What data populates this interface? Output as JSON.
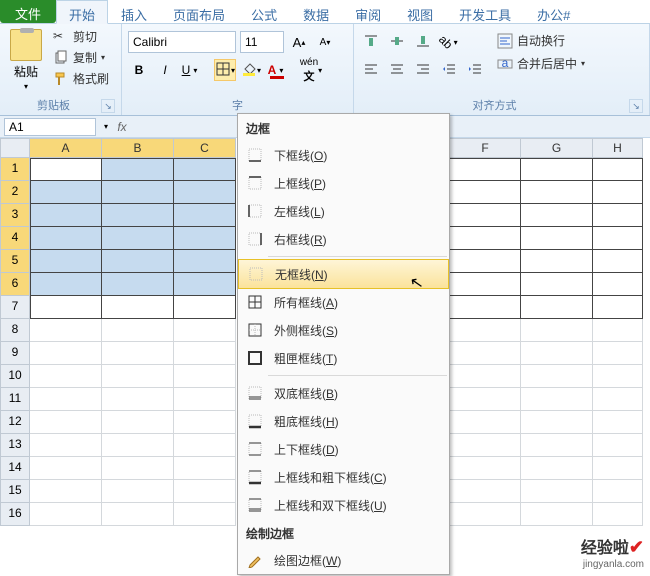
{
  "tabs": {
    "file": "文件",
    "home": "开始",
    "insert": "插入",
    "layout": "页面布局",
    "formula": "公式",
    "data": "数据",
    "review": "审阅",
    "view": "视图",
    "dev": "开发工具",
    "wps": "办公#"
  },
  "clipboard": {
    "paste": "粘贴",
    "cut": "剪切",
    "copy": "复制",
    "format_painter": "格式刷",
    "group_label": "剪贴板"
  },
  "font": {
    "name": "Calibri",
    "size": "11",
    "group_label": "字",
    "bold": "B",
    "italic": "I",
    "underline": "U"
  },
  "align": {
    "wrap": "自动换行",
    "merge": "合并后居中",
    "group_label": "对齐方式"
  },
  "namebox": "A1",
  "columns": [
    "A",
    "B",
    "C",
    "F",
    "G",
    "H"
  ],
  "rows": [
    "1",
    "2",
    "3",
    "4",
    "5",
    "6",
    "7",
    "8",
    "9",
    "10",
    "11",
    "12",
    "13",
    "14",
    "15",
    "16"
  ],
  "dropdown": {
    "header1": "边框",
    "items1": [
      {
        "label_pre": "下框线(",
        "key": "O",
        "label_post": ")",
        "icon": "border-bottom"
      },
      {
        "label_pre": "上框线(",
        "key": "P",
        "label_post": ")",
        "icon": "border-top"
      },
      {
        "label_pre": "左框线(",
        "key": "L",
        "label_post": ")",
        "icon": "border-left"
      },
      {
        "label_pre": "右框线(",
        "key": "R",
        "label_post": ")",
        "icon": "border-right"
      }
    ],
    "items2": [
      {
        "label_pre": "无框线(",
        "key": "N",
        "label_post": ")",
        "icon": "border-none",
        "highlight": true
      },
      {
        "label_pre": "所有框线(",
        "key": "A",
        "label_post": ")",
        "icon": "border-all"
      },
      {
        "label_pre": "外侧框线(",
        "key": "S",
        "label_post": ")",
        "icon": "border-outside"
      },
      {
        "label_pre": "粗匣框线(",
        "key": "T",
        "label_post": ")",
        "icon": "border-thick"
      }
    ],
    "items3": [
      {
        "label_pre": "双底框线(",
        "key": "B",
        "label_post": ")",
        "icon": "border-bottom-double"
      },
      {
        "label_pre": "粗底框线(",
        "key": "H",
        "label_post": ")",
        "icon": "border-bottom-thick"
      },
      {
        "label_pre": "上下框线(",
        "key": "D",
        "label_post": ")",
        "icon": "border-top-bottom"
      },
      {
        "label_pre": "上框线和粗下框线(",
        "key": "C",
        "label_post": ")",
        "icon": "border-top-thickbottom"
      },
      {
        "label_pre": "上框线和双下框线(",
        "key": "U",
        "label_post": ")",
        "icon": "border-top-doublebottom"
      }
    ],
    "header2": "绘制边框",
    "items4": [
      {
        "label_pre": "绘图边框(",
        "key": "W",
        "label_post": ")",
        "icon": "pencil"
      }
    ]
  },
  "watermark": {
    "brand": "经验啦",
    "url": "jingyanla.com"
  }
}
